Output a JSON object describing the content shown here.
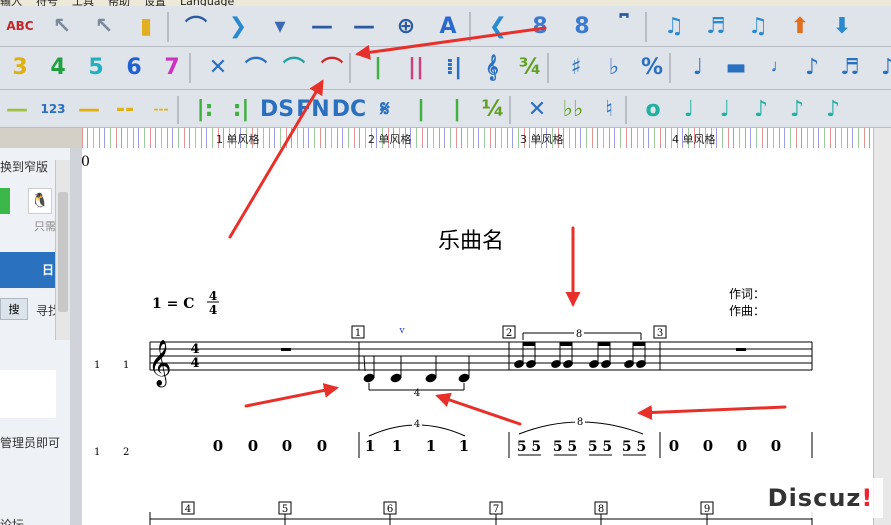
{
  "menu": {
    "items": [
      "输入",
      "符号",
      "工具",
      "帮助",
      "设置",
      "Language"
    ]
  },
  "toolbar1": {
    "items": [
      {
        "name": "abc-spellcheck-icon",
        "glyph": "ABC",
        "color": "#c0282a"
      },
      {
        "name": "select-arrow-icon",
        "glyph": "↖",
        "color": "#7a8a9a"
      },
      {
        "name": "input-cursor-icon",
        "glyph": "↖",
        "color": "#7a8a9a"
      },
      {
        "name": "traffic-light-icon",
        "glyph": "▮",
        "color": "#e0b020"
      },
      {
        "name": "fermata-icon",
        "glyph": "⌒",
        "color": "#2a5aa0"
      },
      {
        "name": "next-arrow-icon",
        "glyph": "❯",
        "color": "#2a8ad0"
      },
      {
        "name": "dropdown-icon",
        "glyph": "▾",
        "color": "#3a6ab0"
      },
      {
        "name": "dash-icon",
        "glyph": "—",
        "color": "#2a5aa0"
      },
      {
        "name": "long-dash-icon",
        "glyph": "—",
        "color": "#2a5aa0"
      },
      {
        "name": "crosshair-icon",
        "glyph": "⊕",
        "color": "#2a5aa0"
      },
      {
        "name": "text-a-icon",
        "glyph": "A",
        "color": "#2a6ad0"
      },
      {
        "name": "decrescendo-icon",
        "glyph": "❮",
        "color": "#2a8ad0"
      },
      {
        "name": "add-voice-icon",
        "glyph": "8",
        "color": "#3a7ad0"
      },
      {
        "name": "remove-voice-icon",
        "glyph": "8",
        "color": "#3a7ad0"
      },
      {
        "name": "tuplet-bracket-icon",
        "glyph": "⎴",
        "color": "#2a5aa0"
      },
      {
        "name": "eighth-pair-icon",
        "glyph": "♫",
        "color": "#2a8ad0"
      },
      {
        "name": "sixteenth-icon",
        "glyph": "♬",
        "color": "#2a8ad0"
      },
      {
        "name": "beamed-notes-icon",
        "glyph": "♫",
        "color": "#2a8ad0"
      },
      {
        "name": "move-up-icon",
        "glyph": "⬆",
        "color": "#e07020"
      },
      {
        "name": "move-down-icon",
        "glyph": "⬇",
        "color": "#2a8ad0"
      }
    ]
  },
  "toolbar2": {
    "items": [
      {
        "name": "number-3-icon",
        "glyph": "3",
        "color": "#e0b010"
      },
      {
        "name": "number-4-icon",
        "glyph": "4",
        "color": "#20a040"
      },
      {
        "name": "number-5-icon",
        "glyph": "5",
        "color": "#20b0c0"
      },
      {
        "name": "number-6-icon",
        "glyph": "6",
        "color": "#2060d0"
      },
      {
        "name": "number-7-icon",
        "glyph": "7",
        "color": "#d030c0"
      },
      {
        "name": "delete-x-icon",
        "glyph": "✕",
        "color": "#2a70c0"
      },
      {
        "name": "slur-icon",
        "glyph": "⌒",
        "color": "#2a70c0"
      },
      {
        "name": "tie-icon",
        "glyph": "⌒",
        "color": "#20a0a0"
      },
      {
        "name": "triplet-slur-icon",
        "glyph": "⌒",
        "color": "#d02828"
      },
      {
        "name": "barline-icon",
        "glyph": "|",
        "color": "#40b040"
      },
      {
        "name": "double-barline-icon",
        "glyph": "||",
        "color": "#d04080"
      },
      {
        "name": "repeat-barline-icon",
        "glyph": "⁞|",
        "color": "#2a70c0"
      },
      {
        "name": "treble-clef-icon",
        "glyph": "𝄞",
        "color": "#2a70c0"
      },
      {
        "name": "time-signature-icon",
        "glyph": "¾",
        "color": "#60a020"
      },
      {
        "name": "sharp-icon",
        "glyph": "♯",
        "color": "#2a70c0"
      },
      {
        "name": "flat-icon",
        "glyph": "♭",
        "color": "#2a70c0"
      },
      {
        "name": "percent-repeat-icon",
        "glyph": "%",
        "color": "#2a70c0"
      },
      {
        "name": "quarter-note-icon",
        "glyph": "♩",
        "color": "#2a70c0"
      },
      {
        "name": "whole-rest-icon",
        "glyph": "▬",
        "color": "#2a70c0"
      },
      {
        "name": "half-note-icon",
        "glyph": "𝅗𝅥",
        "color": "#2a70c0"
      },
      {
        "name": "eighth-note-icon",
        "glyph": "♪",
        "color": "#2a70c0"
      },
      {
        "name": "sixteenth-note-icon",
        "glyph": "♬",
        "color": "#2a70c0"
      },
      {
        "name": "thirtysecond-note-icon",
        "glyph": "♪",
        "color": "#2a70c0"
      }
    ]
  },
  "toolbar3": {
    "items": [
      {
        "name": "line-icon",
        "glyph": "—",
        "color": "#a0c040"
      },
      {
        "name": "numbering-123-icon",
        "glyph": "123",
        "color": "#2a70c0"
      },
      {
        "name": "dash-line-icon",
        "glyph": "—",
        "color": "#e0b010"
      },
      {
        "name": "dotted-line-icon",
        "glyph": "--",
        "color": "#e0b010"
      },
      {
        "name": "dashed-line-icon",
        "glyph": "---",
        "color": "#e0b010"
      },
      {
        "name": "repeat-start-icon",
        "glyph": "|:",
        "color": "#40b040"
      },
      {
        "name": "repeat-end-icon",
        "glyph": ":|",
        "color": "#40b040"
      },
      {
        "name": "ds-icon",
        "glyph": "DS",
        "color": "#2a70c0"
      },
      {
        "name": "fine-icon",
        "glyph": "FN",
        "color": "#2a70c0"
      },
      {
        "name": "dc-icon",
        "glyph": "DC",
        "color": "#2a70c0"
      },
      {
        "name": "segno-icon",
        "glyph": "𝄋",
        "color": "#2a70c0"
      },
      {
        "name": "bar-icon",
        "glyph": "|",
        "color": "#40b040"
      },
      {
        "name": "bar2-icon",
        "glyph": "|",
        "color": "#40b040"
      },
      {
        "name": "time-sig-44-icon",
        "glyph": "¼",
        "color": "#60a020"
      },
      {
        "name": "double-sharp-icon",
        "glyph": "✕",
        "color": "#2a70c0"
      },
      {
        "name": "double-flat-icon",
        "glyph": "♭♭",
        "color": "#60a020"
      },
      {
        "name": "natural-icon",
        "glyph": "♮",
        "color": "#2a70c0"
      },
      {
        "name": "whole-note-icon",
        "glyph": "o",
        "color": "#20b0a0"
      },
      {
        "name": "q-note-icon",
        "glyph": "♩",
        "color": "#20b0a0"
      },
      {
        "name": "h-note-icon",
        "glyph": "♩",
        "color": "#20b0a0"
      },
      {
        "name": "e-note-icon",
        "glyph": "♪",
        "color": "#20b0a0"
      },
      {
        "name": "s-note-icon",
        "glyph": "♪",
        "color": "#20b0a0"
      },
      {
        "name": "t-note-icon",
        "glyph": "♪",
        "color": "#20b0a0"
      }
    ]
  },
  "ruler": {
    "segments": [
      "1 单风格",
      "2 单风格",
      "3 单风格",
      "4 单风格"
    ]
  },
  "left_panel": {
    "items": [
      "换到窄版",
      "只需",
      "日",
      "搜",
      "寻找",
      "管理员即可",
      "论坛"
    ]
  },
  "score": {
    "title": "乐曲名",
    "tempo_label": "1 = C",
    "time_sig_num": "4",
    "time_sig_den": "4",
    "lyricist_label": "作词：",
    "composer_label": "作曲：",
    "row1_labels": [
      "1",
      "1"
    ],
    "row2_labels": [
      "1",
      "2"
    ],
    "measure_numbers": [
      "1",
      "2",
      "3"
    ],
    "measure_numbers_row3": [
      "4",
      "5",
      "6",
      "7",
      "8",
      "9"
    ],
    "tuplet_four": "4",
    "tuplet_eight": "8",
    "jianpu_m1": [
      "0",
      "0",
      "0",
      "0"
    ],
    "jianpu_m2": [
      "1",
      "1",
      "1",
      "1"
    ],
    "jianpu_m3": [
      "5 5",
      "5 5",
      "5 5",
      "5 5"
    ],
    "jianpu_m4": [
      "0",
      "0",
      "0",
      "0"
    ],
    "page_marker": "0"
  },
  "watermark": {
    "text": "Discuz",
    "suffix": "!"
  },
  "colors": {
    "arrow": "#e8302a",
    "staff": "#000000",
    "accent": "#2a70c0"
  }
}
